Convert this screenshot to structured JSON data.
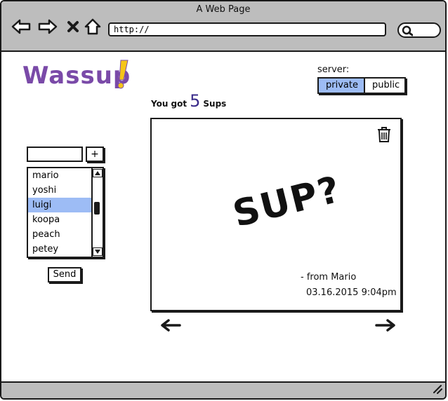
{
  "window": {
    "title": "A Web Page"
  },
  "browser": {
    "url": "http://",
    "icons": [
      "back-arrow-icon",
      "forward-arrow-icon",
      "close-x-icon",
      "home-icon",
      "search-icon"
    ]
  },
  "app": {
    "logo_text": "Wassup",
    "logo_mark": "!",
    "brand_color": "#7a4aa8",
    "accent_color": "#9dbcf5"
  },
  "server": {
    "label": "server:",
    "options": [
      "private",
      "public"
    ],
    "selected": "private"
  },
  "counter": {
    "prefix": "You got",
    "count": "5",
    "suffix": "Sups"
  },
  "compose": {
    "recipient_value": "",
    "add_label": "+",
    "send_label": "Send",
    "contacts": [
      "mario",
      "yoshi",
      "luigi",
      "koopa",
      "peach",
      "petey"
    ],
    "selected_contact": "luigi"
  },
  "sup_card": {
    "message": "SUP?",
    "from": "- from Mario",
    "timestamp": "03.16.2015 9:04pm",
    "delete_icon": "trash-icon"
  },
  "pager": {
    "prev_icon": "arrow-left-icon",
    "next_icon": "arrow-right-icon"
  }
}
